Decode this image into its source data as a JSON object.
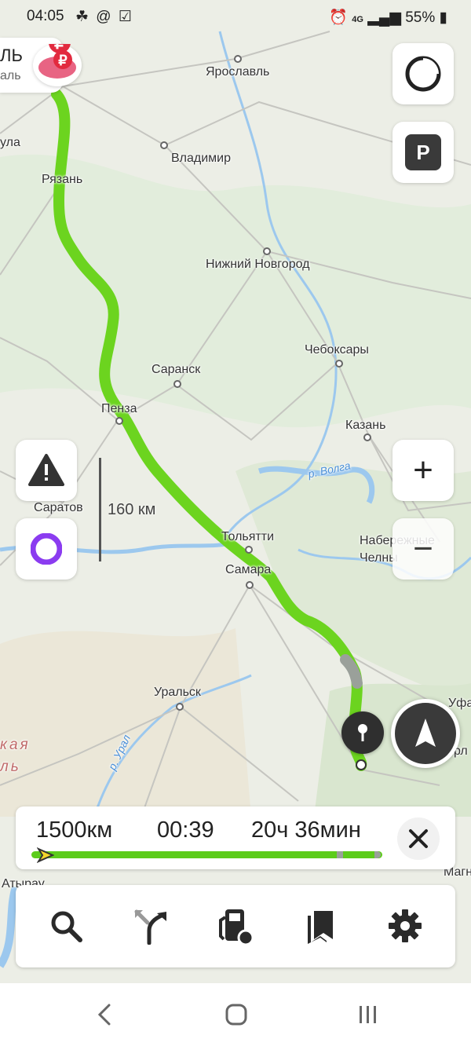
{
  "status_bar": {
    "time": "04:05",
    "left_icons": "☘ @ ☑",
    "network": "4G",
    "battery": "55%"
  },
  "origin_label": {
    "line1": "ЛЬ",
    "line2": "аль"
  },
  "cities": [
    {
      "name": "Ярославль"
    },
    {
      "name": "Владимир"
    },
    {
      "name": "Рязань"
    },
    {
      "name": "Нижний Новгород"
    },
    {
      "name": "Чебоксары"
    },
    {
      "name": "Саранск"
    },
    {
      "name": "Пенза"
    },
    {
      "name": "Казань"
    },
    {
      "name": "Саратов"
    },
    {
      "name": "Набережные Челны"
    },
    {
      "name": "Тольятти"
    },
    {
      "name": "Самара"
    },
    {
      "name": "Уральск"
    },
    {
      "name": "Уфа"
    },
    {
      "name": "Магн"
    },
    {
      "name": "Атырау"
    },
    {
      "name": "ула"
    },
    {
      "name": "рл"
    }
  ],
  "rivers": {
    "volga": "р. Волга",
    "ural": "р. Урал"
  },
  "region_label": "кая ль",
  "scale_label": "160 км",
  "route_panel": {
    "distance": "1500км",
    "elapsed": "00:39",
    "eta": "20ч 36мин",
    "progress": 0.02,
    "close_icon": "close-icon"
  },
  "right_controls": {
    "plus": "+",
    "minus": "−"
  },
  "toolbar": {
    "items": [
      {
        "icon": "search-icon"
      },
      {
        "icon": "route-icon"
      },
      {
        "icon": "fuel-icon"
      },
      {
        "icon": "bookmarks-icon"
      },
      {
        "icon": "settings-icon"
      }
    ]
  },
  "parking_label": "P",
  "colors": {
    "route": "#6cd41f",
    "route_congested": "#9aa09a",
    "alice": "#8b3cf0",
    "dark_button": "#3a3a3a"
  }
}
